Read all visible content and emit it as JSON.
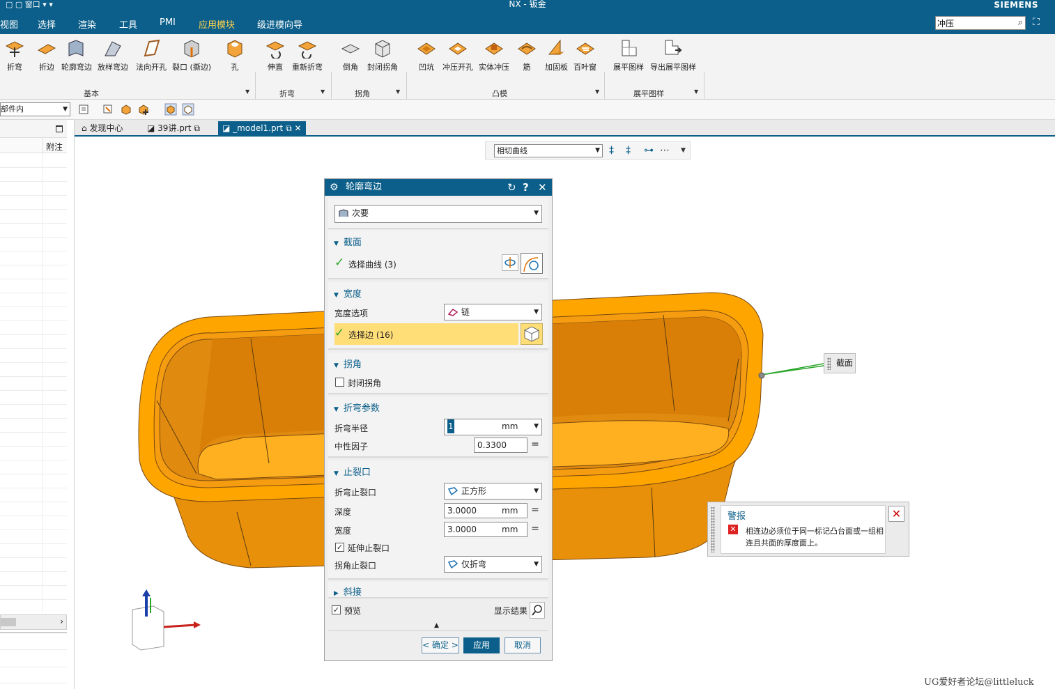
{
  "titlebar": {
    "quick_access": "窗口",
    "title": "NX - 钣金",
    "brand": "SIEMENS"
  },
  "menu": {
    "items": [
      "视图",
      "选择",
      "渲染",
      "工具",
      "PMI",
      "应用模块",
      "级进模向导"
    ],
    "active": "应用模块"
  },
  "command_search": {
    "value": "冲压"
  },
  "ribbon": {
    "basic": [
      "折弯",
      "折边",
      "轮廓弯边",
      "放样弯边",
      "法向开孔",
      "裂口 (撕边)",
      "孔"
    ],
    "bend": [
      "伸直",
      "重新折弯"
    ],
    "corner": [
      "倒角",
      "封闭拐角"
    ],
    "punch": [
      "凹坑",
      "冲压开孔",
      "实体冲压",
      "筋",
      "加固板",
      "百叶窗"
    ],
    "flat": [
      "展平图样",
      "导出展平图样"
    ],
    "groups": {
      "basic": "基本",
      "bend": "折弯",
      "corner": "拐角",
      "punch": "凸模",
      "flat": "展平图样"
    }
  },
  "selection_bar": {
    "filter": "部件内"
  },
  "left_panel": {
    "column": "附注"
  },
  "tabs": [
    {
      "label": "发现中心"
    },
    {
      "label": "39讲.prt"
    },
    {
      "label": "_model1.prt"
    }
  ],
  "view_toolbar": {
    "curve_rule": "相切曲线"
  },
  "dialog": {
    "title": "轮廓弯边",
    "type": "次要",
    "section": {
      "header": "截面",
      "select_curve": "选择曲线 (3)"
    },
    "width": {
      "header": "宽度",
      "option_label": "宽度选项",
      "option_value": "链",
      "select_edge": "选择边 (16)"
    },
    "corner": {
      "header": "拐角",
      "close_corner": "封闭拐角"
    },
    "bend_params": {
      "header": "折弯参数",
      "radius_label": "折弯半径",
      "radius_value": "1",
      "radius_unit": "mm",
      "neutral_label": "中性因子",
      "neutral_value": "0.3300"
    },
    "relief": {
      "header": "止裂口",
      "bend_relief_label": "折弯止裂口",
      "bend_relief_value": "正方形",
      "depth_label": "深度",
      "depth_value": "3.0000",
      "depth_unit": "mm",
      "width_label": "宽度",
      "width_value": "3.0000",
      "width_unit": "mm",
      "extend_label": "延伸止裂口",
      "corner_relief_label": "拐角止裂口",
      "corner_relief_value": "仅折弯"
    },
    "miter": {
      "header": "斜接"
    },
    "preview": {
      "label": "预览",
      "show_result": "显示结果"
    },
    "buttons": {
      "ok": "< 确定 >",
      "apply": "应用",
      "cancel": "取消"
    }
  },
  "alert": {
    "title": "警报",
    "message": "相连边必须位于同一标记凸台面或一组相连且共面的厚度面上。"
  },
  "callout": {
    "label": "截面"
  },
  "watermark": "UG爱好者论坛@littleluck",
  "colors": {
    "nx_blue": "#0b5f8a",
    "part_orange": "#ffa500",
    "highlight": "#ffdd77"
  }
}
